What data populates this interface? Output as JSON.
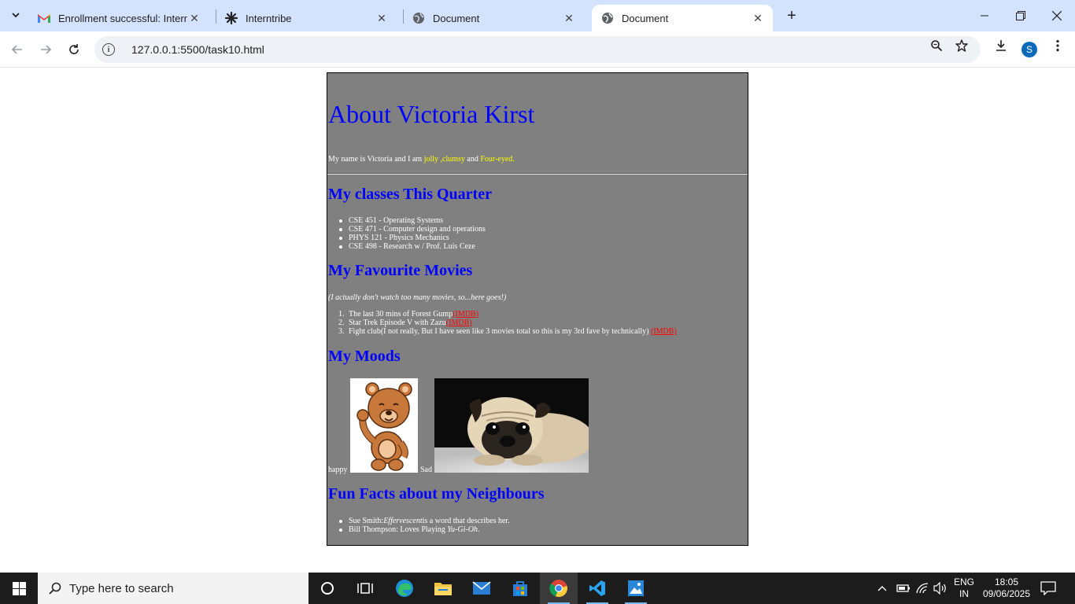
{
  "browser": {
    "tabs": [
      {
        "title": "Enrollment successful: Interntri",
        "icon": "gmail-icon",
        "active": false
      },
      {
        "title": "Interntribe",
        "icon": "interntribe-icon",
        "active": false
      },
      {
        "title": "Document",
        "icon": "globe-icon",
        "active": false
      },
      {
        "title": "Document",
        "icon": "globe-icon",
        "active": true
      }
    ],
    "address": "127.0.0.1:5500/task10.html",
    "profile_initial": "S"
  },
  "page": {
    "title": "About Victoria Kirst",
    "intro": {
      "before": "My name is Victoria and I am ",
      "jolly": "jolly",
      "clumsy": " ,clumsy",
      "and": " and ",
      "four_eyed": "Four-eyed."
    },
    "classes_heading": "My classes This Quarter",
    "classes": [
      "CSE 451 - Operating Systems",
      "CSE 471 - Computer design and operations",
      "PHYS 121 - Physics Mechanics",
      "CSE 498 - Research w / Prof. Luis Ceze"
    ],
    "movies_heading": "My Favourite Movies",
    "movies_note": "(I actually don't watch too many movies, so...here goes!)",
    "movies": [
      {
        "num": "1.",
        "text": "The last 30 mins of Forest Gump",
        "link": "(IMDB)"
      },
      {
        "num": "2.",
        "text": "Star Trek Episode V with Zazu",
        "link": "(IMDB)"
      },
      {
        "num": "3.",
        "text": "Fight club(I not really, But I have seen like 3 movies total so this is my 3rd fave by technically) ",
        "link": "(IMDB)"
      }
    ],
    "moods_heading": "My Moods",
    "mood_happy": "happy",
    "mood_sad": "Sad",
    "neighbours_heading": "Fun Facts about my Neighbours",
    "neighbours": [
      {
        "before": "Sue Smith:",
        "em": "Effervescent",
        "after": "is a word that describes her."
      },
      {
        "before": "Bill Thompson: Loves Playing ",
        "em": "Yu-Gi-Oh",
        "after": "."
      }
    ]
  },
  "taskbar": {
    "search_placeholder": "Type here to search",
    "lang_top": "ENG",
    "lang_bottom": "IN",
    "time": "18:05",
    "date": "09/06/2025"
  },
  "colors": {
    "page_bg": "#808080",
    "heading": "#0000ff",
    "highlight": "#ffff00",
    "link": "#ff0000",
    "tabstrip": "#d3e3fd"
  }
}
